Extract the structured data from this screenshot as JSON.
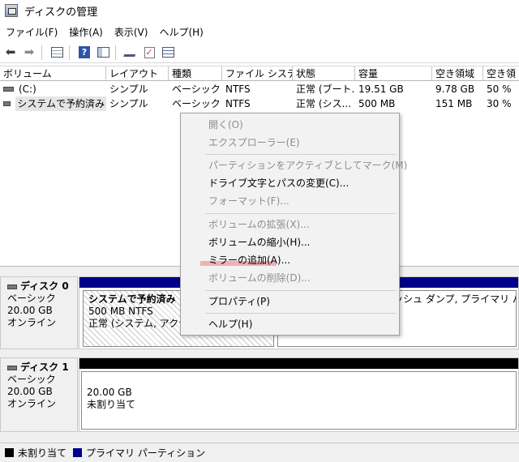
{
  "window": {
    "title": "ディスクの管理"
  },
  "menu": [
    "ファイル(F)",
    "操作(A)",
    "表示(V)",
    "ヘルプ(H)"
  ],
  "toolbar": [
    "back-icon",
    "forward-icon",
    "grid-view-icon",
    "help-icon",
    "list-view-icon",
    "connect-icon",
    "check-icon",
    "properties-icon"
  ],
  "volume_table": {
    "columns": [
      "ボリューム",
      "レイアウト",
      "種類",
      "ファイル システム",
      "状態",
      "容量",
      "空き領域",
      "空き領"
    ],
    "rows": [
      [
        "(C:)",
        "シンプル",
        "ベーシック",
        "NTFS",
        "正常 (ブート...",
        "19.51 GB",
        "9.78 GB",
        "50 %"
      ],
      [
        "システムで予約済み",
        "シンプル",
        "ベーシック",
        "NTFS",
        "正常 (シス...",
        "500 MB",
        "151 MB",
        "30 %"
      ]
    ]
  },
  "disks": [
    {
      "name": "ディスク 0",
      "type": "ベーシック",
      "size": "20.00 GB",
      "status": "オンライン",
      "partitions": [
        {
          "name": "システムで予約済み",
          "size": "500 MB NTFS",
          "status": "正常 (システム, アクティブ"
        },
        {
          "name": "",
          "size": "",
          "status": "ッシュ ダンプ, プライマリ パーティ"
        }
      ]
    },
    {
      "name": "ディスク 1",
      "type": "ベーシック",
      "size": "20.00 GB",
      "status": "オンライン",
      "partitions": [
        {
          "size": "20.00 GB",
          "status": "未割り当て"
        }
      ]
    }
  ],
  "legend": [
    {
      "label": "未割り当て",
      "color": "#000000"
    },
    {
      "label": "プライマリ パーティション",
      "color": "#00008b"
    }
  ],
  "context_menu": {
    "items": [
      {
        "label": "開く(O)",
        "enabled": false
      },
      {
        "label": "エクスプローラー(E)",
        "enabled": false
      },
      {
        "label": "パーティションをアクティブとしてマーク(M)",
        "enabled": false
      },
      {
        "label": "ドライブ文字とパスの変更(C)...",
        "enabled": true
      },
      {
        "label": "フォーマット(F)...",
        "enabled": false
      },
      {
        "label": "ボリュームの拡張(X)...",
        "enabled": false
      },
      {
        "label": "ボリュームの縮小(H)...",
        "enabled": true
      },
      {
        "label": "ミラーの追加(A)...",
        "enabled": true
      },
      {
        "label": "ボリュームの削除(D)...",
        "enabled": false
      },
      {
        "label": "プロパティ(P)",
        "enabled": true
      },
      {
        "label": "ヘルプ(H)",
        "enabled": true
      }
    ]
  }
}
